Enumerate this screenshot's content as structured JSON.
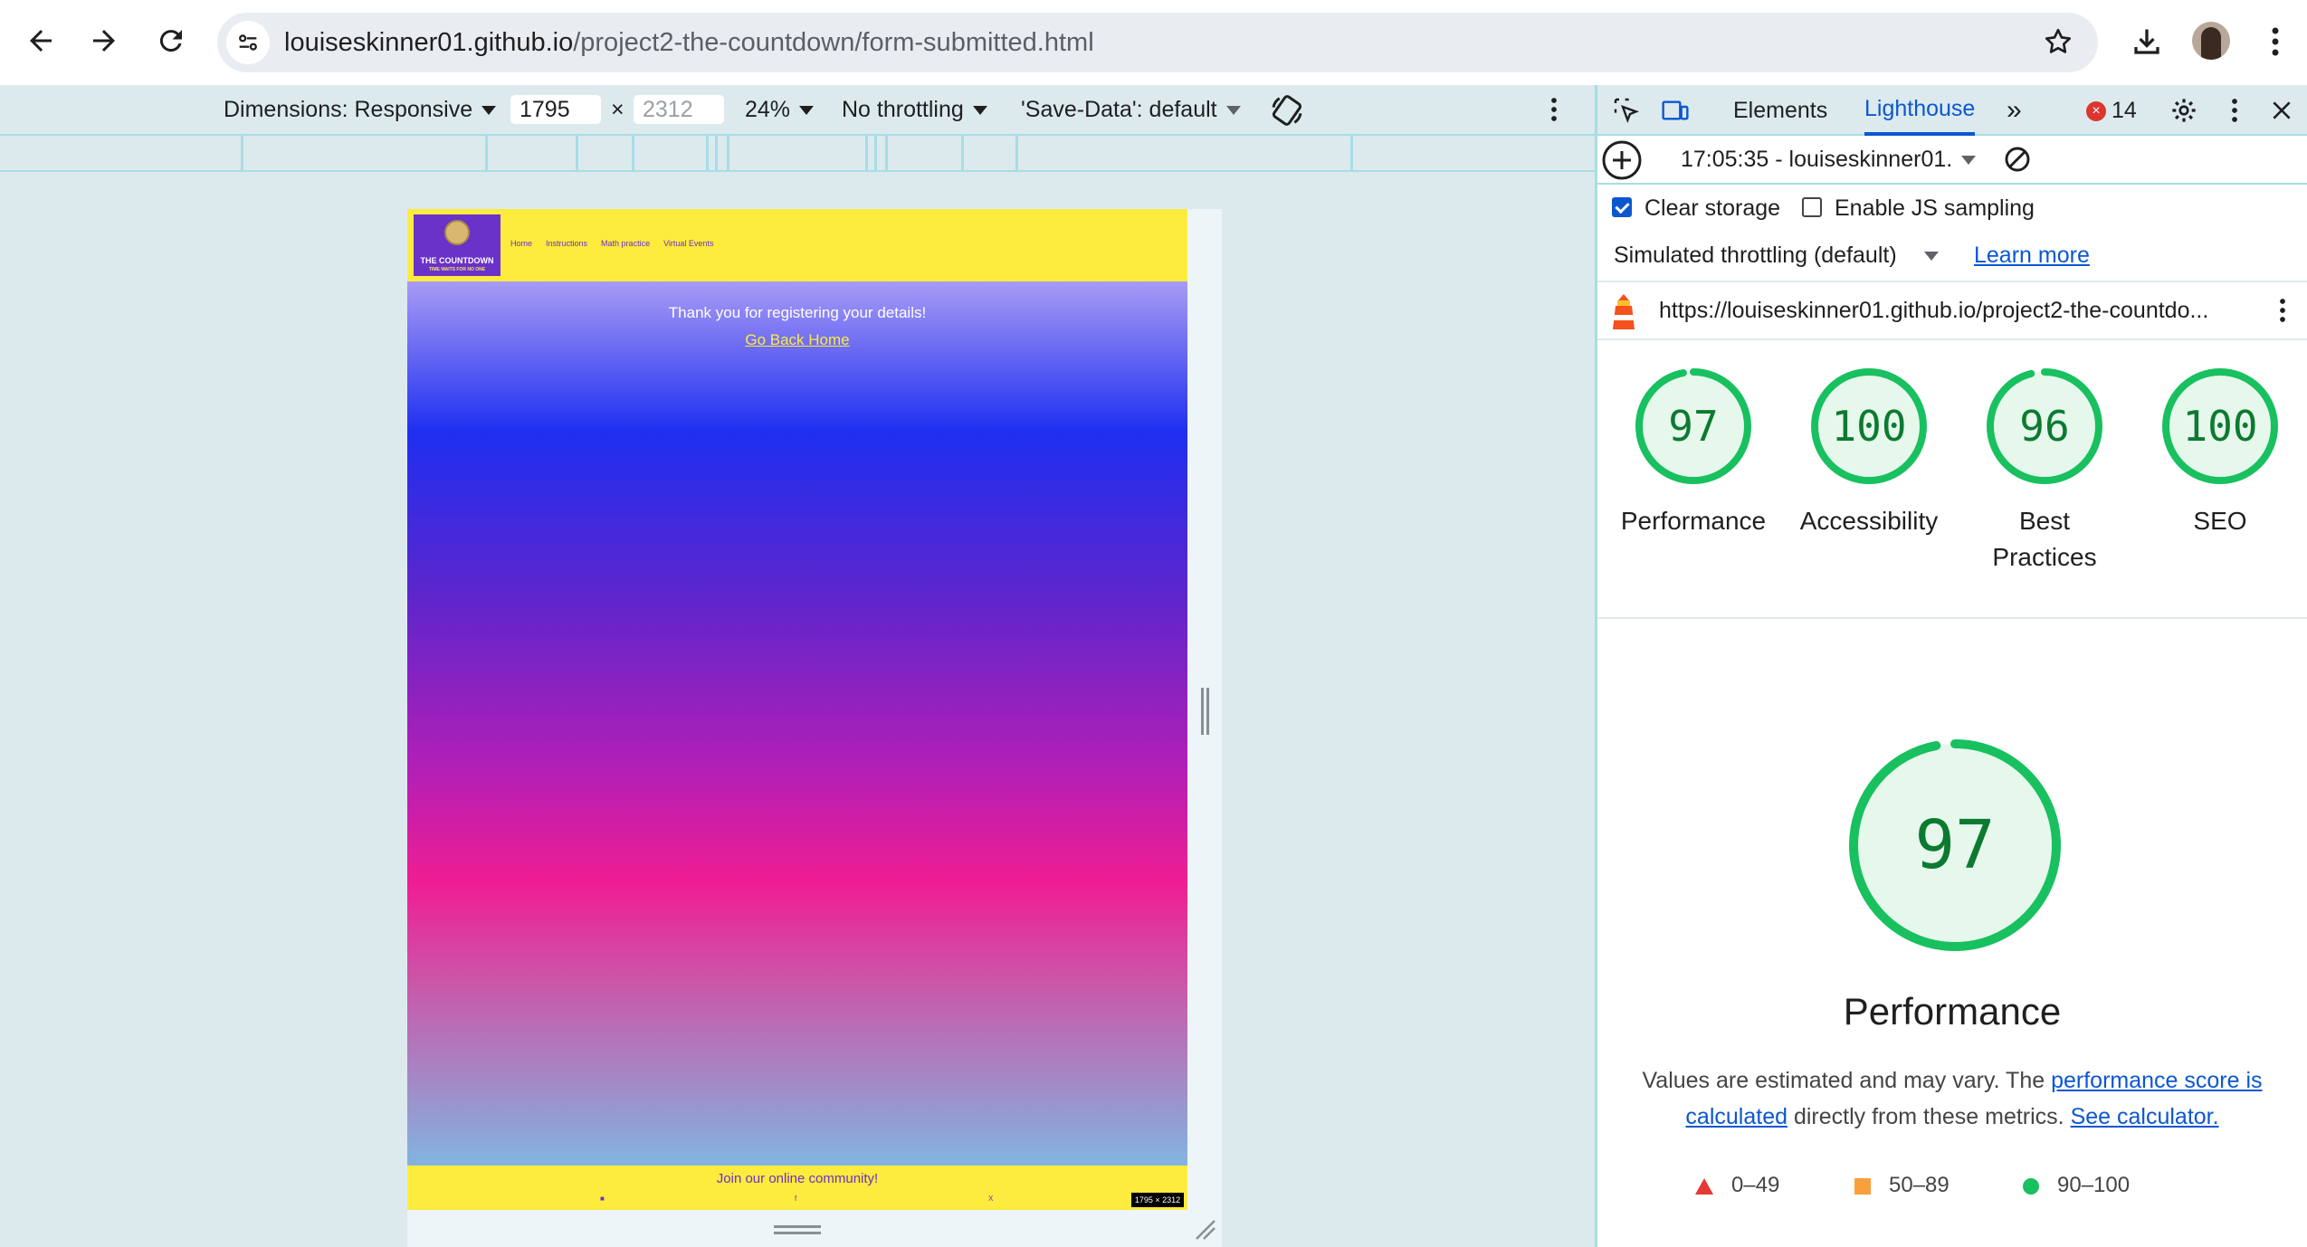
{
  "browser": {
    "url_host": "louiseskinner01.github.io",
    "url_path": "/project2-the-countdown/form-submitted.html"
  },
  "device_toolbar": {
    "dimensions_label": "Dimensions: Responsive",
    "width_value": "1795",
    "times": "×",
    "height_placeholder": "2312",
    "zoom": "24%",
    "throttling": "No throttling",
    "save_data": "'Save-Data': default"
  },
  "site": {
    "logo_title": "THE COUNTDOWN",
    "logo_tagline": "TIME WAITS FOR NO ONE",
    "menu": [
      "Home",
      "Instructions",
      "Math practice",
      "Virtual Events"
    ],
    "thanks_text": "Thank you for registering your details!",
    "home_link": "Go Back Home",
    "footer_text": "Join our online community!",
    "footer_icons": [
      "instagram-icon",
      "facebook-icon",
      "x-icon"
    ],
    "size_badge": "1795 × 2312"
  },
  "devtools": {
    "tabs": [
      "Elements",
      "Lighthouse"
    ],
    "more_tabs": "»",
    "error_count": "14",
    "report_select": "17:05:35 - louiseskinner01.",
    "clear_storage": "Clear storage",
    "clear_storage_checked": true,
    "enable_js_sampling": "Enable JS sampling",
    "enable_js_sampling_checked": false,
    "throttling_select": "Simulated throttling (default)",
    "learn_more": "Learn more",
    "report_url": "https://louiseskinner01.github.io/project2-the-countdo...",
    "scores": [
      {
        "value": "97",
        "label": "Performance"
      },
      {
        "value": "100",
        "label": "Accessibility"
      },
      {
        "value": "96",
        "label": "Best Practices"
      },
      {
        "value": "100",
        "label": "SEO"
      }
    ],
    "big_score": "97",
    "big_title": "Performance",
    "desc_prefix": "Values are estimated and may vary. The ",
    "desc_link1": "performance score is calculated",
    "desc_mid": " directly from these metrics. ",
    "desc_link2": "See calculator.",
    "legend": [
      "0–49",
      "50–89",
      "90–100"
    ],
    "colors": {
      "pass": "#18c060",
      "average": "#f9a03d",
      "fail": "#e53935",
      "accent": "#0b57d0"
    }
  }
}
